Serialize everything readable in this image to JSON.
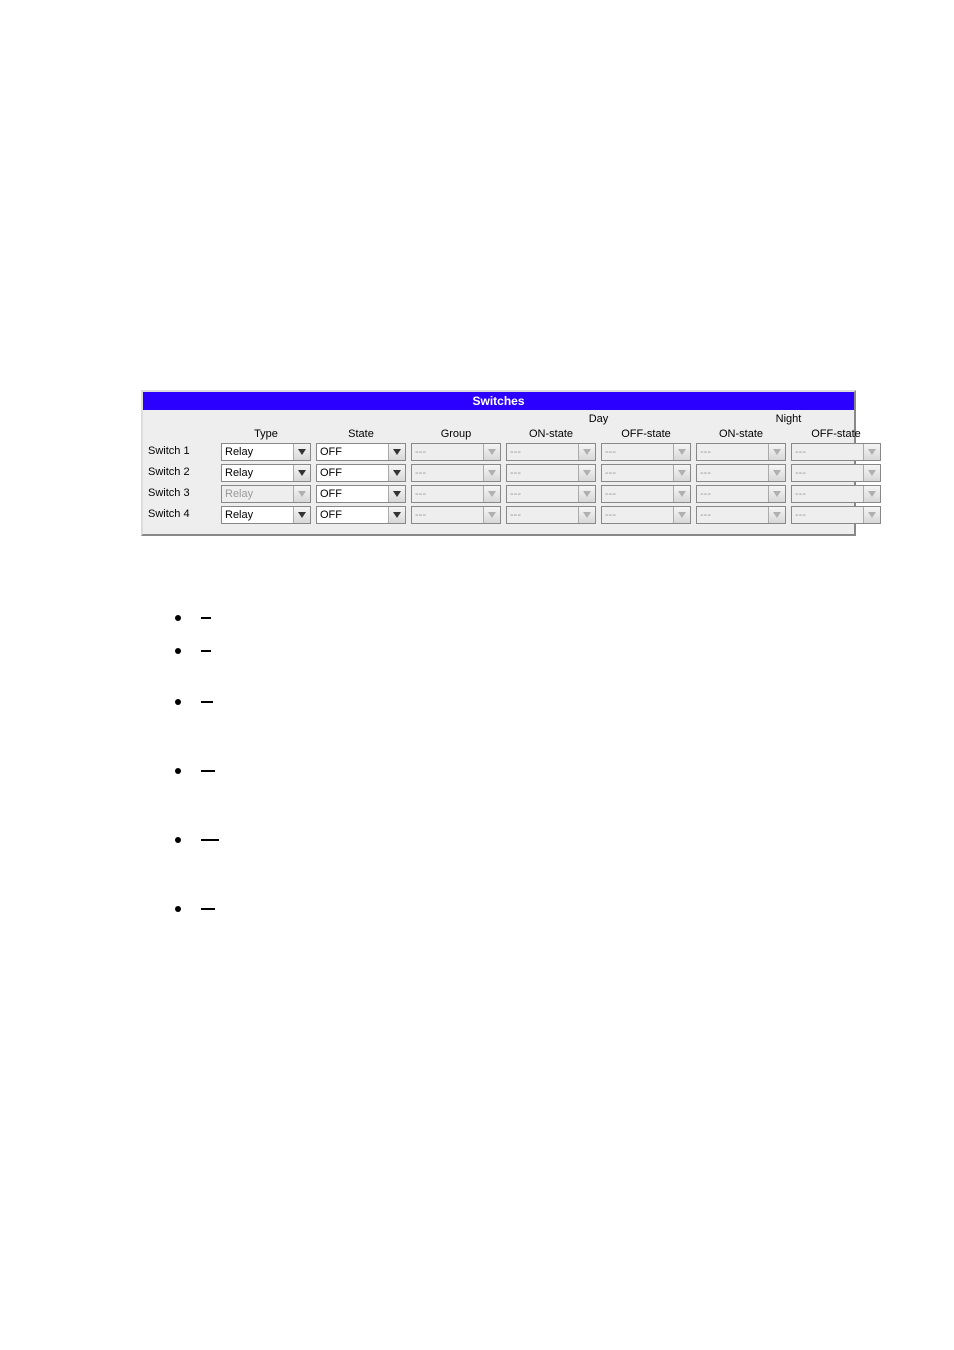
{
  "panel": {
    "title": "Switches",
    "headers": {
      "type": "Type",
      "state": "State",
      "group": "Group",
      "day": "Day",
      "night": "Night",
      "on_state": "ON-state",
      "off_state": "OFF-state"
    },
    "rows": [
      {
        "label": "Switch 1",
        "type": {
          "value": "Relay",
          "enabled": true
        },
        "state": {
          "value": "OFF",
          "enabled": true
        },
        "group": {
          "value": "---",
          "enabled": false
        },
        "day_on": {
          "value": "---",
          "enabled": false
        },
        "day_off": {
          "value": "---",
          "enabled": false
        },
        "night_on": {
          "value": "---",
          "enabled": false
        },
        "night_off": {
          "value": "---",
          "enabled": false
        }
      },
      {
        "label": "Switch 2",
        "type": {
          "value": "Relay",
          "enabled": true
        },
        "state": {
          "value": "OFF",
          "enabled": true
        },
        "group": {
          "value": "---",
          "enabled": false
        },
        "day_on": {
          "value": "---",
          "enabled": false
        },
        "day_off": {
          "value": "---",
          "enabled": false
        },
        "night_on": {
          "value": "---",
          "enabled": false
        },
        "night_off": {
          "value": "---",
          "enabled": false
        }
      },
      {
        "label": "Switch 3",
        "type": {
          "value": "Relay",
          "enabled": false
        },
        "state": {
          "value": "OFF",
          "enabled": true
        },
        "group": {
          "value": "---",
          "enabled": false
        },
        "day_on": {
          "value": "---",
          "enabled": false
        },
        "day_off": {
          "value": "---",
          "enabled": false
        },
        "night_on": {
          "value": "---",
          "enabled": false
        },
        "night_off": {
          "value": "---",
          "enabled": false
        }
      },
      {
        "label": "Switch 4",
        "type": {
          "value": "Relay",
          "enabled": true
        },
        "state": {
          "value": "OFF",
          "enabled": true
        },
        "group": {
          "value": "---",
          "enabled": false
        },
        "day_on": {
          "value": "---",
          "enabled": false
        },
        "day_off": {
          "value": "---",
          "enabled": false
        },
        "night_on": {
          "value": "---",
          "enabled": false
        },
        "night_off": {
          "value": "---",
          "enabled": false
        }
      }
    ]
  },
  "bullets": [
    {
      "dash_w": 10,
      "lines": 1
    },
    {
      "dash_w": 10,
      "lines": 2
    },
    {
      "dash_w": 12,
      "lines": 3
    },
    {
      "dash_w": 14,
      "lines": 3
    },
    {
      "dash_w": 18,
      "lines": 3
    },
    {
      "dash_w": 14,
      "lines": 3
    }
  ]
}
